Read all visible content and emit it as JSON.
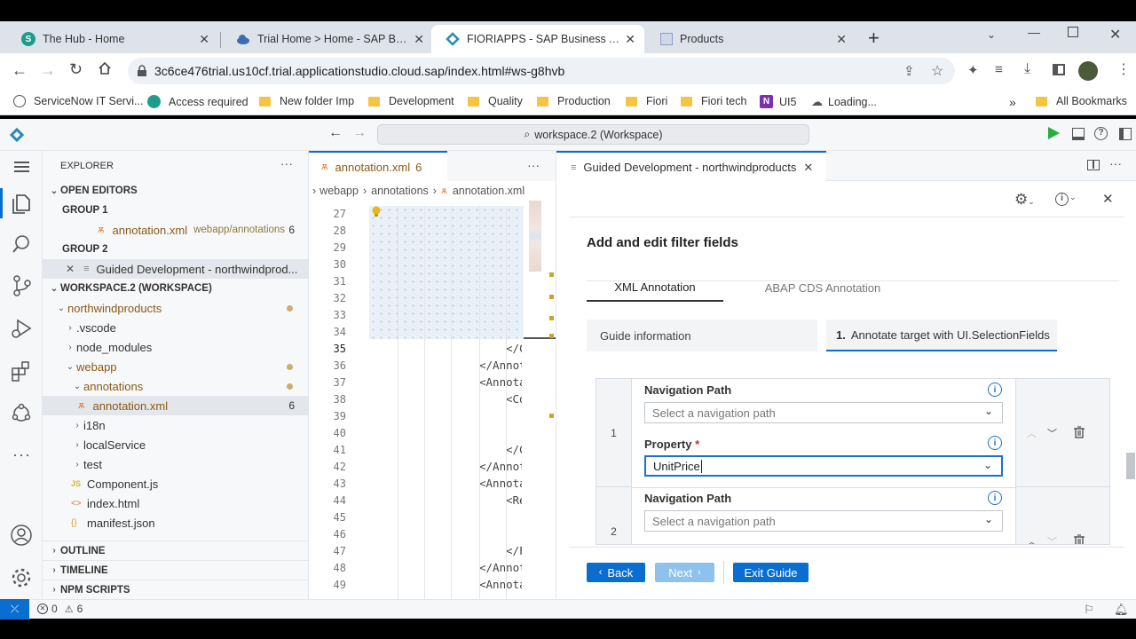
{
  "browser": {
    "tabs": [
      {
        "title": "The Hub - Home",
        "icon": "s-icon"
      },
      {
        "title": "Trial Home > Home - SAP BTP C",
        "icon": "cloud-icon"
      },
      {
        "title": "FIORIAPPS - SAP Business Applic",
        "icon": "bas-icon"
      },
      {
        "title": "Products",
        "icon": "page-icon"
      }
    ],
    "active_tab": 2,
    "url": "3c6ce476trial.us10cf.trial.applicationstudio.cloud.sap/index.html#ws-g8hvb",
    "bookmarks": [
      "ServiceNow IT Servi...",
      "Access required",
      "New folder Imp",
      "Development",
      "Quality",
      "Production",
      "Fiori",
      "Fiori tech",
      "UI5",
      "Loading..."
    ],
    "all_bookmarks": "All Bookmarks",
    "overflow": "»"
  },
  "bas": {
    "command_center": "workspace.2 (Workspace)"
  },
  "explorer": {
    "title": "EXPLORER",
    "more": "···",
    "open_editors": "OPEN EDITORS",
    "group1": "GROUP 1",
    "group1_file": "annotation.xml",
    "group1_path": "webapp/annotations",
    "group1_count": "6",
    "group2": "GROUP 2",
    "group2_file": "Guided Development - northwindprod...",
    "workspace": "WORKSPACE.2 (WORKSPACE)",
    "tree": [
      {
        "label": "northwindproducts",
        "indent": 1,
        "open": true
      },
      {
        "label": ".vscode",
        "indent": 2,
        "open": false
      },
      {
        "label": "node_modules",
        "indent": 2,
        "open": false
      },
      {
        "label": "webapp",
        "indent": 2,
        "open": true
      },
      {
        "label": "annotations",
        "indent": 3,
        "open": true
      },
      {
        "label": "annotation.xml",
        "indent": 4
      },
      {
        "label": "i18n",
        "indent": 3,
        "open": false
      },
      {
        "label": "localService",
        "indent": 3,
        "open": false
      },
      {
        "label": "test",
        "indent": 3,
        "open": false
      },
      {
        "label": "Component.js",
        "indent": 3
      },
      {
        "label": "index.html",
        "indent": 3
      },
      {
        "label": "manifest.json",
        "indent": 3
      }
    ],
    "annotation_count": "6",
    "outline": "OUTLINE",
    "timeline": "TIMELINE",
    "npm": "NPM SCRIPTS"
  },
  "editor": {
    "tab": "annotation.xml",
    "tab_count": "6",
    "more": "···",
    "breadcrumb": [
      "webapp",
      "annotations",
      "annotation.xml"
    ],
    "lines": [
      "27",
      "28",
      "29",
      "30",
      "31",
      "32",
      "33",
      "34",
      "35",
      "36",
      "37",
      "38",
      "39",
      "40",
      "41",
      "42",
      "43",
      "44",
      "45",
      "46",
      "47",
      "48",
      "49"
    ],
    "current_line": "35",
    "code": {
      "35": "</C",
      "36": "</Annot",
      "37": "<Annota",
      "38": "<Co",
      "41": "</C",
      "42": "</Annot",
      "43": "<Annota",
      "44": "<Re",
      "47": "</F",
      "48": "</Annot",
      "49": "<Annota"
    }
  },
  "guided": {
    "tab": "Guided Development - northwindproducts",
    "heading": "Add and edit filter fields",
    "tabs": [
      "XML Annotation",
      "ABAP CDS Annotation"
    ],
    "guide_info": "Guide information",
    "step_num": "1.",
    "step_label": "Annotate target with UI.SelectionFields",
    "rows": [
      {
        "index": "1",
        "nav_label": "Navigation Path",
        "nav_placeholder": "Select a navigation path",
        "prop_label": "Property",
        "required": "*",
        "prop_value": "UnitPrice"
      },
      {
        "index": "2",
        "nav_label": "Navigation Path",
        "nav_placeholder": "Select a navigation path"
      }
    ],
    "back": "Back",
    "next": "Next",
    "exit": "Exit Guide"
  },
  "status": {
    "errors": "0",
    "warnings": "6"
  },
  "colors": {
    "sap_blue": "#0a6ed1",
    "link_blue": "#1a73c8",
    "selection_blue": "#e8f0fb"
  }
}
